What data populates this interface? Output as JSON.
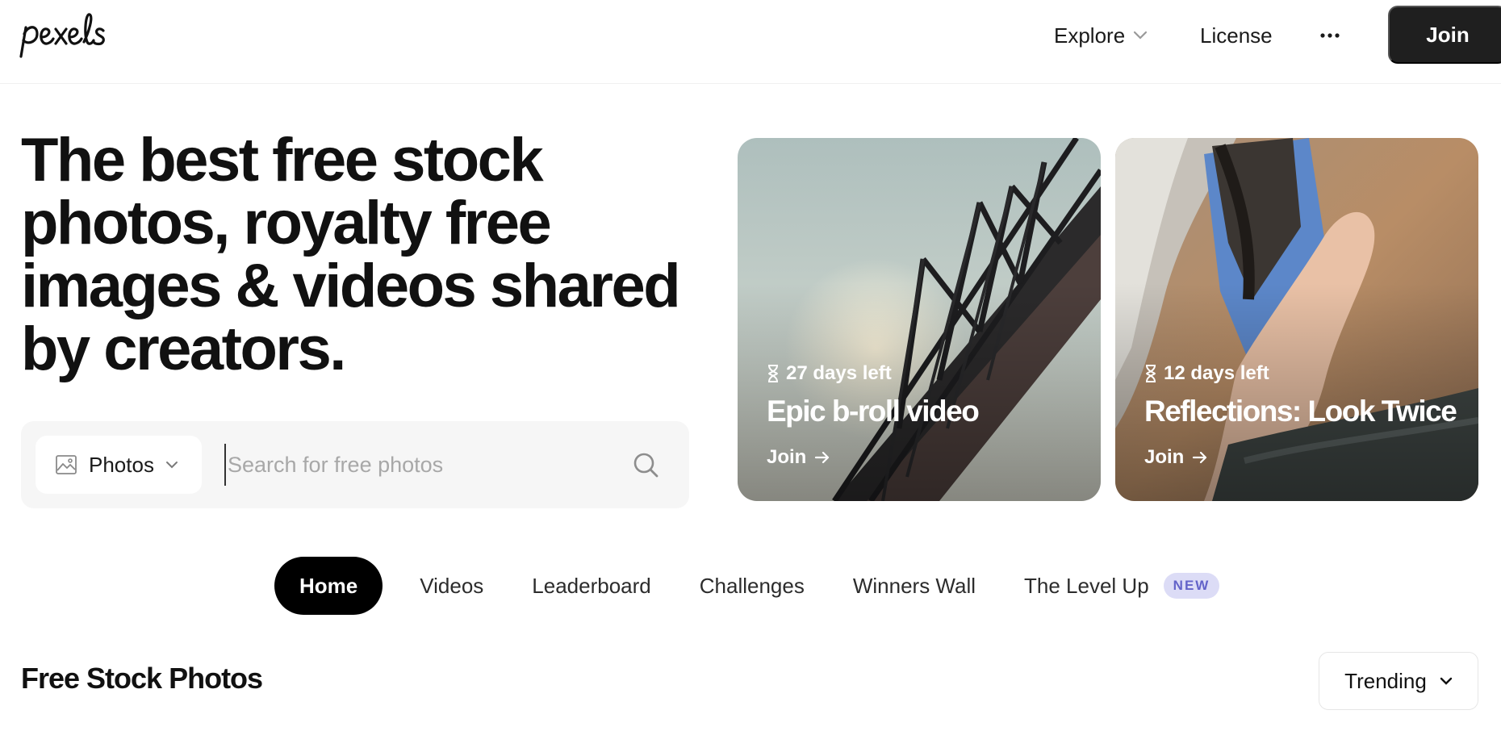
{
  "header": {
    "logo_text": "pexels",
    "explore_label": "Explore",
    "license_label": "License",
    "join_label": "Join"
  },
  "hero": {
    "title": "The best free stock photos, royalty free images & videos shared by creators."
  },
  "search": {
    "type_label": "Photos",
    "placeholder": "Search for free photos",
    "value": ""
  },
  "challenges": [
    {
      "days_left": "27 days left",
      "title": "Epic b-roll video",
      "join_label": "Join"
    },
    {
      "days_left": "12 days left",
      "title": "Reflections: Look Twice",
      "join_label": "Join"
    }
  ],
  "tabs": [
    {
      "label": "Home",
      "active": true
    },
    {
      "label": "Videos"
    },
    {
      "label": "Leaderboard"
    },
    {
      "label": "Challenges"
    },
    {
      "label": "Winners Wall"
    },
    {
      "label": "The Level Up",
      "badge": "NEW"
    }
  ],
  "section": {
    "title": "Free Stock Photos",
    "sort_label": "Trending"
  },
  "colors": {
    "primary_dark": "#1f1f1f",
    "badge_bg": "#dcdcf6",
    "badge_text": "#6363c9",
    "search_bg": "#f6f6f6"
  },
  "icons": [
    "chevron-down-icon",
    "more-dots-icon",
    "image-icon",
    "search-icon",
    "hourglass-icon",
    "arrow-right-icon"
  ]
}
